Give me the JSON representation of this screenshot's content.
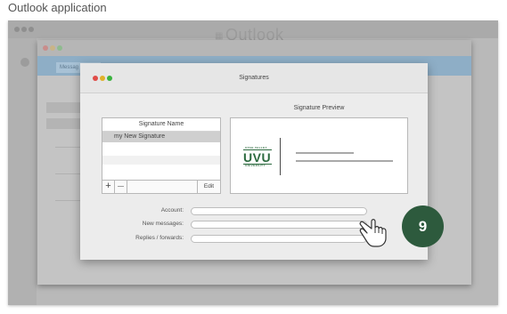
{
  "caption": "Outlook application",
  "outer_window": {
    "title": "Outlook"
  },
  "middle_window": {
    "tab_label": "Messag"
  },
  "dialog": {
    "title": "Signatures",
    "list": {
      "header": "Signature Name",
      "items": [
        "my New Signature"
      ],
      "add_label": "+",
      "remove_label": "—",
      "edit_label": "Edit"
    },
    "preview": {
      "label": "Signature Preview",
      "logo_top": "UTAH VALLEY",
      "logo_main": "UVU",
      "logo_bottom": "UNIVERSITY"
    },
    "fields": {
      "account_label": "Account:",
      "new_messages_label": "New messages:",
      "replies_label": "Replies / forwards:"
    }
  },
  "step_badge": "9",
  "colors": {
    "badge": "#2d5a3d",
    "logo": "#2c6a3f",
    "close": "#e04c48",
    "minimize": "#e0b12a",
    "zoom": "#3bb33f"
  },
  "icons": [
    "grid-icon",
    "pointing-hand-cursor-icon"
  ]
}
